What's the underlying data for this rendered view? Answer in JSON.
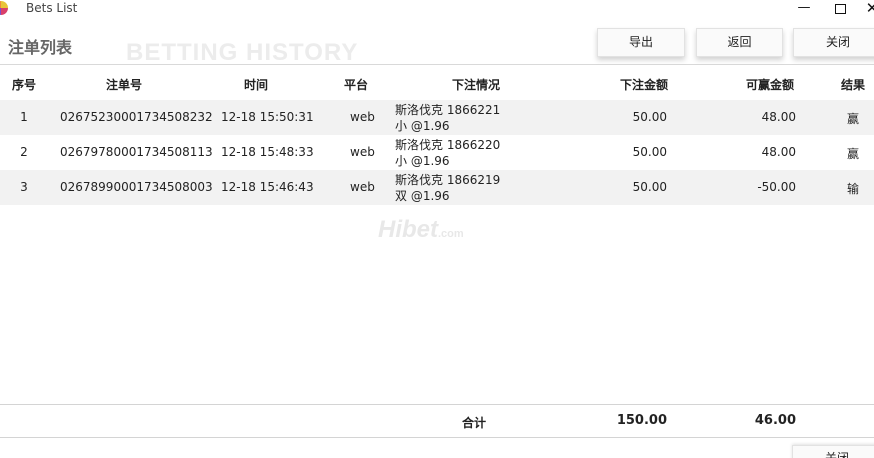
{
  "window": {
    "title": "Bets List",
    "minimize_glyph": "—",
    "close_glyph": "✕"
  },
  "header": {
    "title": "注单列表",
    "watermark": "BETTING HISTORY",
    "buttons": {
      "export": "导出",
      "back": "返回",
      "close": "关闭"
    }
  },
  "table": {
    "columns": {
      "index": "序号",
      "bet_no": "注单号",
      "time": "时间",
      "platform": "平台",
      "details": "下注情况",
      "amount": "下注金额",
      "winnable": "可赢金额",
      "result": "结果"
    },
    "rows": [
      {
        "index": "1",
        "bet_no": "02675230001734508232",
        "time": "12-18 15:50:31",
        "platform": "web",
        "detail_line1": "斯洛伐克 1866221",
        "detail_line2": "小 @1.96",
        "amount": "50.00",
        "winnable": "48.00",
        "result": "赢"
      },
      {
        "index": "2",
        "bet_no": "02679780001734508113",
        "time": "12-18 15:48:33",
        "platform": "web",
        "detail_line1": "斯洛伐克 1866220",
        "detail_line2": "小 @1.96",
        "amount": "50.00",
        "winnable": "48.00",
        "result": "赢"
      },
      {
        "index": "3",
        "bet_no": "02678990001734508003",
        "time": "12-18 15:46:43",
        "platform": "web",
        "detail_line1": "斯洛伐克 1866219",
        "detail_line2": "双 @1.96",
        "amount": "50.00",
        "winnable": "-50.00",
        "result": "输"
      }
    ]
  },
  "watermark_brand": {
    "text": "Hibet",
    "suffix": ".com"
  },
  "footer": {
    "total_label": "合计",
    "total_amount": "150.00",
    "total_winnable": "46.00"
  },
  "bottom_button": "关闭"
}
